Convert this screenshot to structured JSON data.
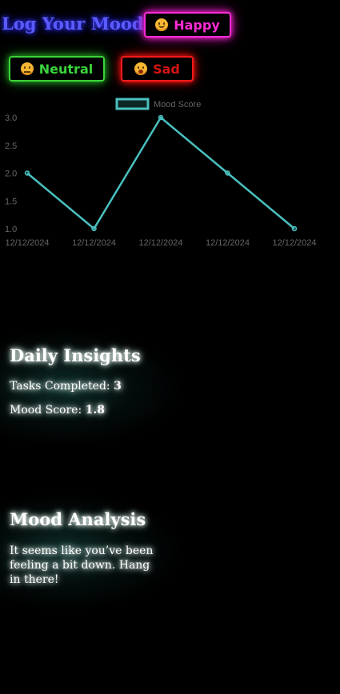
{
  "header": {
    "title": "Log Your Mood:"
  },
  "mood_buttons": [
    {
      "label": "Happy",
      "icon": "smiling-face-icon",
      "color": "#ff2bd6"
    },
    {
      "label": "Neutral",
      "icon": "neutral-face-icon",
      "color": "#3ad43a"
    },
    {
      "label": "Sad",
      "icon": "flushed-face-icon",
      "color": "#ff1a1a"
    }
  ],
  "chart_data": {
    "type": "line",
    "categories": [
      "12/12/2024",
      "12/12/2024",
      "12/12/2024",
      "12/12/2024",
      "12/12/2024"
    ],
    "series": [
      {
        "name": "Mood Score",
        "values": [
          2,
          1,
          3,
          2,
          1
        ],
        "color": "#4bc0c0"
      }
    ],
    "ylim": [
      1,
      3
    ],
    "yticks": [
      "1.0",
      "1.5",
      "2.0",
      "2.5",
      "3.0"
    ],
    "legend": "top-center",
    "grid": false
  },
  "insights": {
    "heading": "Daily Insights",
    "tasks_label": "Tasks Completed:",
    "tasks_value": "3",
    "mood_label": "Mood Score:",
    "mood_value": "1.8"
  },
  "analysis": {
    "heading": "Mood Analysis",
    "text": "It seems like you’ve been feeling a bit down. Hang in there!"
  }
}
